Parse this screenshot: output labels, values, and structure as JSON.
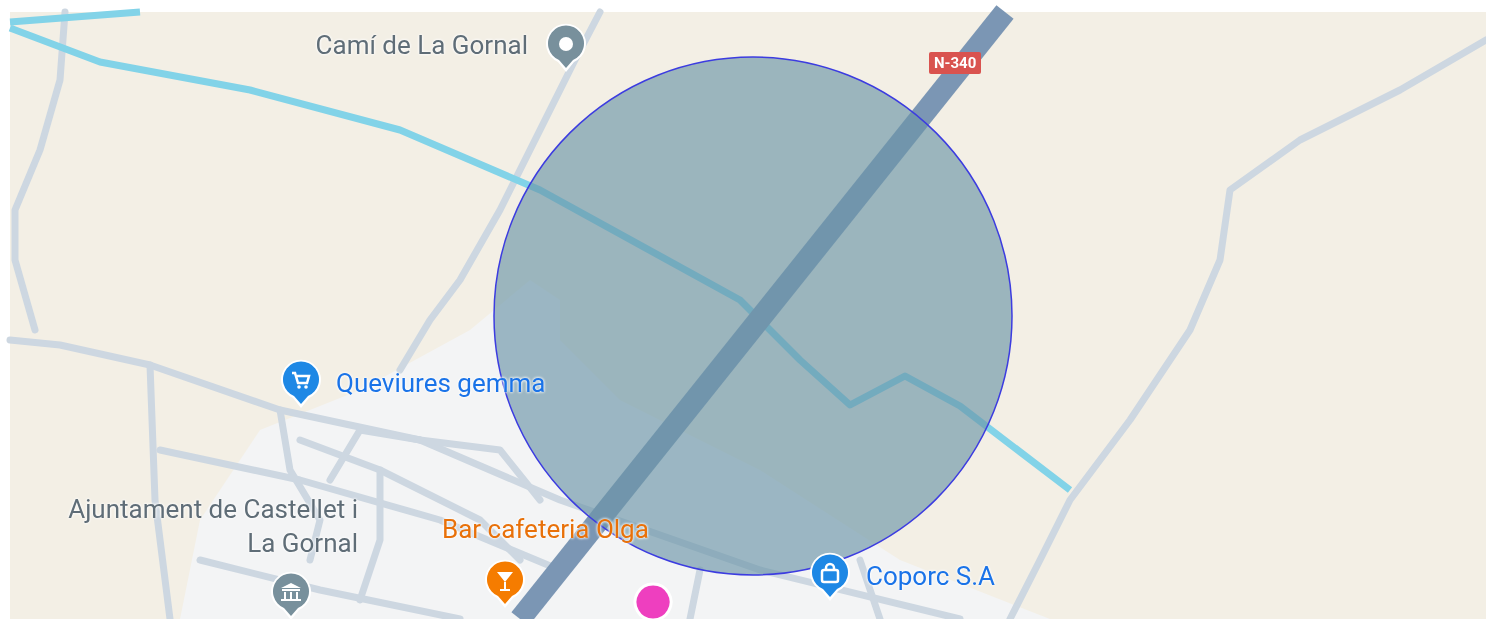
{
  "map": {
    "road_shield": "N-340",
    "places": [
      {
        "name": "Camí de La Gornal",
        "kind": "place",
        "color": "#78909c"
      },
      {
        "name": "Queviures gemma",
        "kind": "shop",
        "color": "#1e88e5"
      },
      {
        "name": "Ajuntament de Castellet i La Gornal",
        "kind": "civic",
        "color": "#78909c"
      },
      {
        "name": "Bar cafeteria Olga",
        "kind": "bar",
        "color": "#f57c00"
      },
      {
        "name": "Coporc S.A",
        "kind": "store",
        "color": "#1e88e5"
      }
    ]
  }
}
